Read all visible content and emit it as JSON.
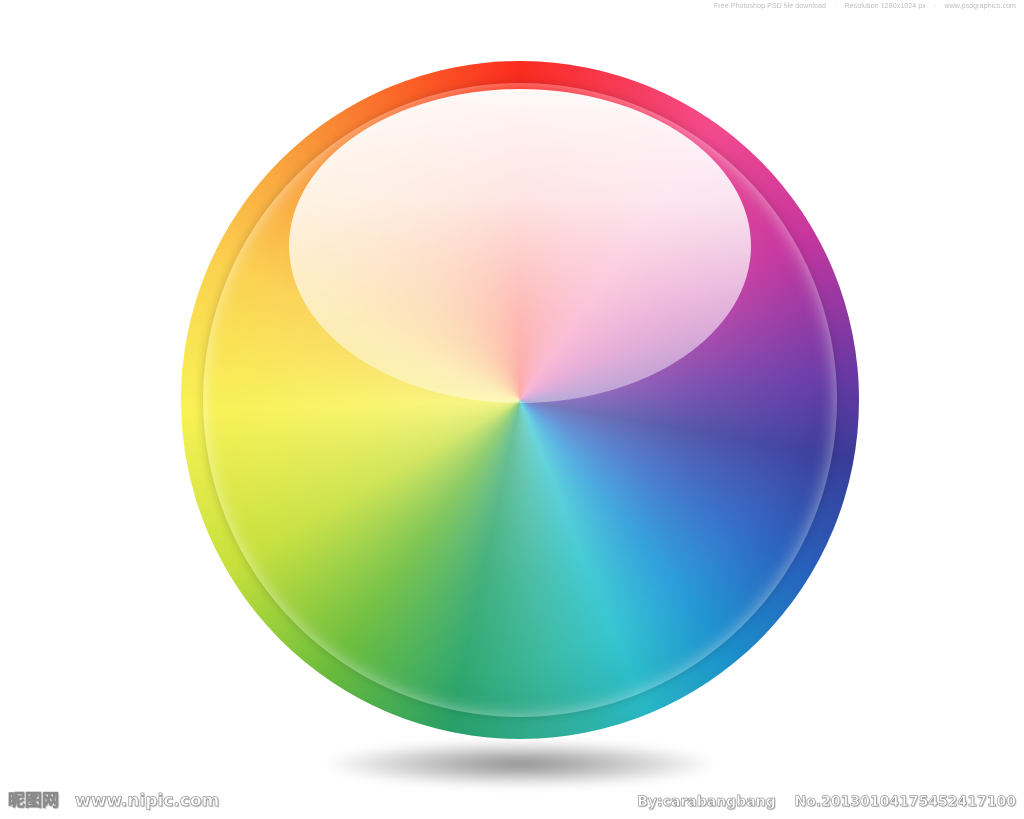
{
  "watermark_top": {
    "part1": "Free Photoshop PSD file download",
    "separator": "-",
    "part2": "Resolution 1280x1024 px",
    "part3": "www.psdgraphics.com"
  },
  "watermark_bottom_left": {
    "logo": "昵图网",
    "url": "www.nipic.com"
  },
  "watermark_bottom_right": {
    "author": "By:carabangbang",
    "number": "No.20130104175452417100"
  },
  "colors": {
    "background": "#ffffff",
    "top_red": "#fb2b1f",
    "pink": "#f34a8d",
    "purple": "#6d3aa8",
    "blue": "#2a65c6",
    "cyan": "#2bc3d0",
    "green": "#2aa56b",
    "yellow": "#f8f255",
    "orange": "#f9973a"
  }
}
